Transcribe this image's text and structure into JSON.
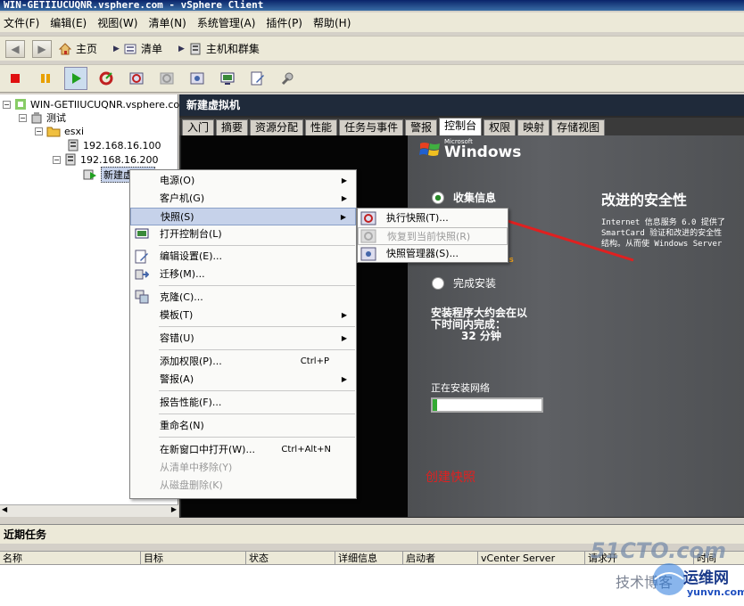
{
  "window": {
    "title": "WIN-GETIIUCUQNR.vsphere.com - vSphere Client"
  },
  "menu": [
    "文件(F)",
    "编辑(E)",
    "视图(W)",
    "清单(N)",
    "系统管理(A)",
    "插件(P)",
    "帮助(H)"
  ],
  "nav": {
    "home": "主页",
    "inventory": "清单",
    "hosts": "主机和群集"
  },
  "tree": {
    "vcenter": "WIN-GETIIUCUQNR.vsphere.com",
    "datacenter": "测试",
    "cluster": "esxi",
    "host1": "192.168.16.100",
    "host2": "192.168.16.200",
    "vm": "新建虚拟机"
  },
  "panel": {
    "title": "新建虚拟机",
    "tabs": [
      "入门",
      "摘要",
      "资源分配",
      "性能",
      "任务与事件",
      "警报",
      "控制台",
      "权限",
      "映射",
      "存储视图"
    ],
    "active_tab": "控制台"
  },
  "console": {
    "brand_small": "Microsoft",
    "brand": "Windows",
    "step1": "收集信息",
    "step2_partial": "Windows",
    "step3": "完成安装",
    "heading": "改进的安全性",
    "desc_lines": [
      "Internet 信息服务 6.0 提供了",
      "SmartCard 验证和改进的安全性",
      "结构。从而使 Windows Server"
    ],
    "time_line1": "安装程序大约会在以",
    "time_line2": "下时间内完成：",
    "time_value": "32 分钟",
    "installing": "正在安装网络",
    "annotation": "创建快照"
  },
  "context_menu": [
    {
      "label": "电源(O)",
      "arrow": true
    },
    {
      "label": "客户机(G)",
      "arrow": true
    },
    {
      "label": "快照(S)",
      "arrow": true,
      "highlight": true
    },
    {
      "label": "打开控制台(L)"
    },
    {
      "label": "编辑设置(E)..."
    },
    {
      "label": "迁移(M)..."
    },
    {
      "label": "克隆(C)..."
    },
    {
      "label": "模板(T)",
      "arrow": true
    },
    {
      "label": "容错(U)",
      "arrow": true
    },
    {
      "label": "添加权限(P)...",
      "shortcut": "Ctrl+P"
    },
    {
      "label": "警报(A)",
      "arrow": true
    },
    {
      "label": "报告性能(F)..."
    },
    {
      "label": "重命名(N)"
    },
    {
      "label": "在新窗口中打开(W)...",
      "shortcut": "Ctrl+Alt+N"
    },
    {
      "label": "从清单中移除(Y)",
      "disabled": true
    },
    {
      "label": "从磁盘删除(K)",
      "disabled": true
    }
  ],
  "submenu": [
    {
      "label": "执行快照(T)..."
    },
    {
      "label": "恢复到当前快照(R)",
      "disabled": true
    },
    {
      "label": "快照管理器(S)..."
    }
  ],
  "tasks": {
    "title": "近期任务",
    "columns": [
      "名称",
      "目标",
      "状态",
      "详细信息",
      "启动者",
      "vCenter Server",
      "请求开",
      "时间"
    ]
  },
  "watermark": {
    "site": "51CTO.com",
    "sub": "技术博客",
    "brand": "运维网",
    "url": "yunvn.com"
  },
  "colors": {
    "accent": "#c6d2ea",
    "annotation_red": "#e02020",
    "titlebar": "#0a246a"
  }
}
